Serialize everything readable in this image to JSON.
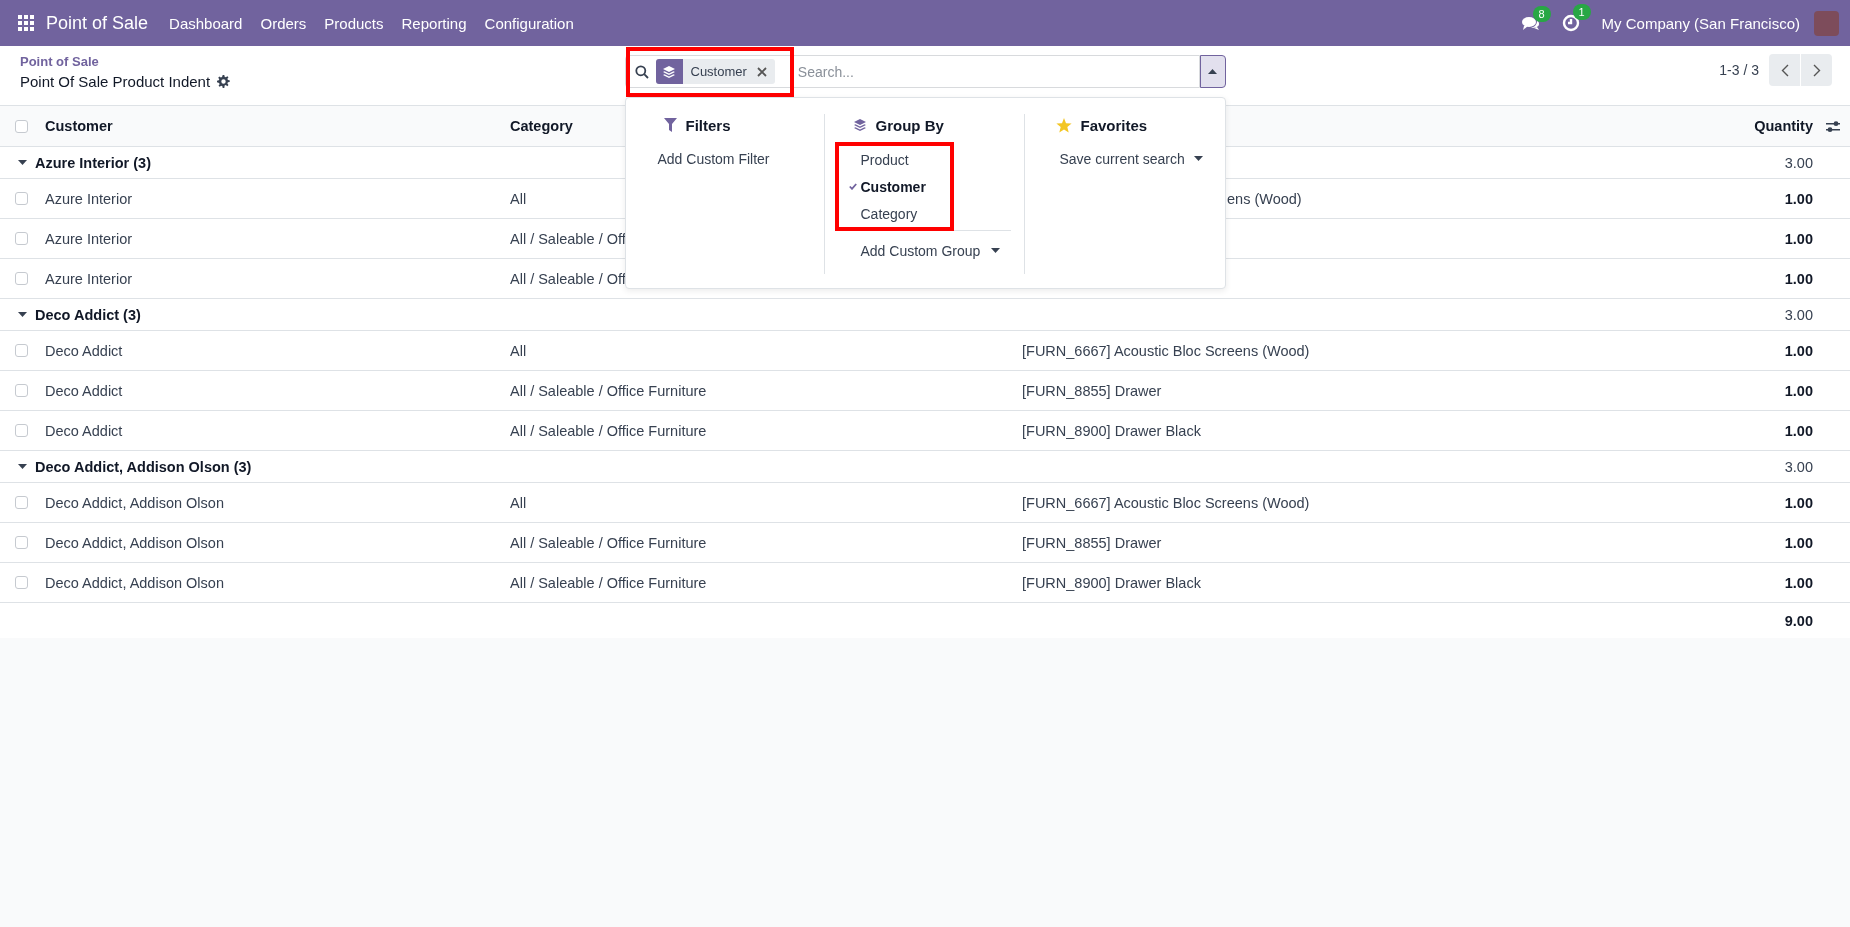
{
  "navbar": {
    "app_name": "Point of Sale",
    "menu": [
      "Dashboard",
      "Orders",
      "Products",
      "Reporting",
      "Configuration"
    ],
    "messages_badge": "8",
    "activities_badge": "1",
    "company": "My Company (San Francisco)"
  },
  "breadcrumb": {
    "parent": "Point of Sale",
    "current": "Point Of Sale Product Indent"
  },
  "search": {
    "facet": "Customer",
    "placeholder": "Search...",
    "expanded": true
  },
  "pager": "1-3 / 3",
  "search_panel": {
    "filters": {
      "title": "Filters",
      "items": [
        "Add Custom Filter"
      ]
    },
    "group_by": {
      "title": "Group By",
      "options": [
        {
          "label": "Product",
          "selected": false
        },
        {
          "label": "Customer",
          "selected": true
        },
        {
          "label": "Category",
          "selected": false
        }
      ],
      "add": "Add Custom Group"
    },
    "favorites": {
      "title": "Favorites",
      "save": "Save current search"
    }
  },
  "table": {
    "all_checked": false,
    "columns": {
      "customer": "Customer",
      "category": "Category",
      "quantity": "Quantity"
    },
    "groups": [
      {
        "label": "Azure Interior (3)",
        "expanded": true,
        "total": "3.00",
        "rows": [
          {
            "customer": "Azure Interior",
            "category": "All",
            "product": "ens (Wood)",
            "quantity": "1.00",
            "checked": false
          },
          {
            "customer": "Azure Interior",
            "category": "All / Saleable / Off",
            "quantity": "1.00",
            "checked": false
          },
          {
            "customer": "Azure Interior",
            "category": "All / Saleable / Off",
            "quantity": "1.00",
            "checked": false
          }
        ]
      },
      {
        "label": "Deco Addict (3)",
        "expanded": true,
        "total": "3.00",
        "rows": [
          {
            "customer": "Deco Addict",
            "category": "All",
            "product": "[FURN_6667] Acoustic Bloc Screens (Wood)",
            "quantity": "1.00",
            "checked": false
          },
          {
            "customer": "Deco Addict",
            "category": "All / Saleable / Office Furniture",
            "product": "[FURN_8855] Drawer",
            "quantity": "1.00",
            "checked": false
          },
          {
            "customer": "Deco Addict",
            "category": "All / Saleable / Office Furniture",
            "product": "[FURN_8900] Drawer Black",
            "quantity": "1.00",
            "checked": false
          }
        ]
      },
      {
        "label": "Deco Addict, Addison Olson (3)",
        "expanded": true,
        "total": "3.00",
        "rows": [
          {
            "customer": "Deco Addict, Addison Olson",
            "category": "All",
            "product": "[FURN_6667] Acoustic Bloc Screens (Wood)",
            "quantity": "1.00",
            "checked": false
          },
          {
            "customer": "Deco Addict, Addison Olson",
            "category": "All / Saleable / Office Furniture",
            "product": "[FURN_8855] Drawer",
            "quantity": "1.00",
            "checked": false
          },
          {
            "customer": "Deco Addict, Addison Olson",
            "category": "All / Saleable / Office Furniture",
            "product": "[FURN_8900] Drawer Black",
            "quantity": "1.00",
            "checked": false
          }
        ]
      }
    ],
    "total": "9.00"
  }
}
